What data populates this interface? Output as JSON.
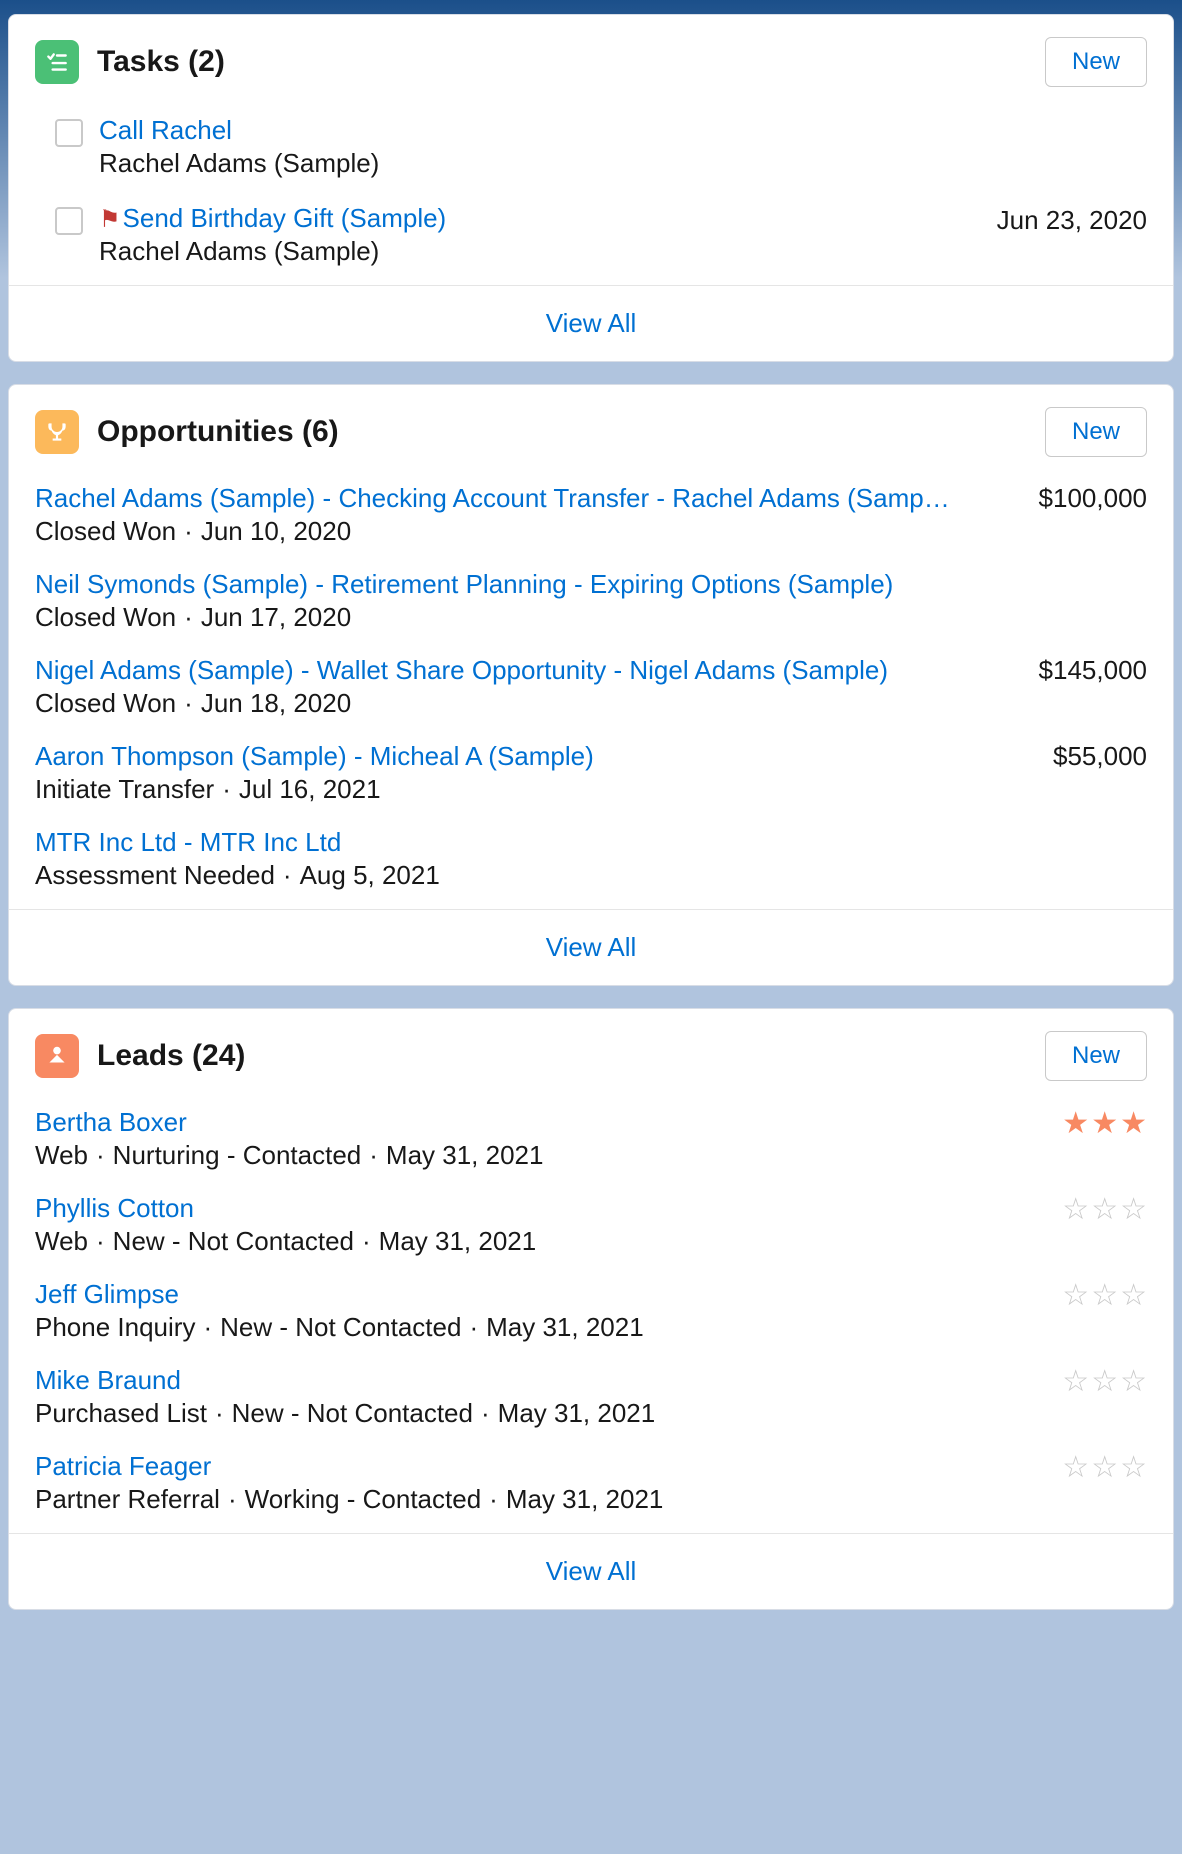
{
  "common": {
    "new_label": "New",
    "view_all_label": "View All",
    "sep": "·"
  },
  "tasks": {
    "title": "Tasks (2)",
    "items": [
      {
        "title": "Call Rachel",
        "subtitle": "Rachel Adams (Sample)",
        "flag": false,
        "date": ""
      },
      {
        "title": "Send Birthday Gift (Sample)",
        "subtitle": "Rachel Adams (Sample)",
        "flag": true,
        "date": "Jun 23, 2020"
      }
    ]
  },
  "opportunities": {
    "title": "Opportunities (6)",
    "items": [
      {
        "title": "Rachel Adams (Sample) - Checking Account Transfer - Rachel Adams (Samp…",
        "stage": "Closed Won",
        "date": "Jun 10, 2020",
        "amount": "$100,000"
      },
      {
        "title": "Neil Symonds (Sample) - Retirement Planning - Expiring Options (Sample)",
        "stage": "Closed Won",
        "date": "Jun 17, 2020",
        "amount": ""
      },
      {
        "title": "Nigel Adams (Sample) - Wallet Share Opportunity - Nigel Adams (Sample)",
        "stage": "Closed Won",
        "date": "Jun 18, 2020",
        "amount": "$145,000"
      },
      {
        "title": "Aaron Thompson (Sample) - Micheal A (Sample)",
        "stage": "Initiate Transfer",
        "date": "Jul 16, 2021",
        "amount": "$55,000"
      },
      {
        "title": "MTR Inc Ltd - MTR Inc Ltd",
        "stage": "Assessment Needed",
        "date": "Aug 5, 2021",
        "amount": ""
      }
    ]
  },
  "leads": {
    "title": "Leads (24)",
    "items": [
      {
        "name": "Bertha Boxer",
        "source": "Web",
        "status": "Nurturing - Contacted",
        "date": "May 31, 2021",
        "rating": 3
      },
      {
        "name": "Phyllis Cotton",
        "source": "Web",
        "status": "New - Not Contacted",
        "date": "May 31, 2021",
        "rating": 0
      },
      {
        "name": "Jeff Glimpse",
        "source": "Phone Inquiry",
        "status": "New - Not Contacted",
        "date": "May 31, 2021",
        "rating": 0
      },
      {
        "name": "Mike Braund",
        "source": "Purchased List",
        "status": "New - Not Contacted",
        "date": "May 31, 2021",
        "rating": 0
      },
      {
        "name": "Patricia Feager",
        "source": "Partner Referral",
        "status": "Working - Contacted",
        "date": "May 31, 2021",
        "rating": 0
      }
    ]
  }
}
